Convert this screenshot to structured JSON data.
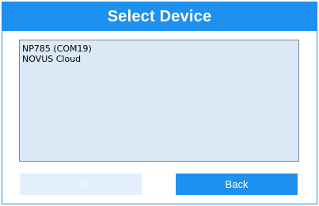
{
  "dialog": {
    "title": "Select Device"
  },
  "device_list": {
    "items": [
      {
        "label": "NP785 (COM19)"
      },
      {
        "label": "NOVUS Cloud"
      }
    ]
  },
  "buttons": {
    "ok_label": "Ok",
    "ok_state": "disabled",
    "back_label": "Back"
  },
  "colors": {
    "accent": "#1e90f0",
    "list_background": "#dbe9f7",
    "disabled_button": "#e3effb"
  }
}
